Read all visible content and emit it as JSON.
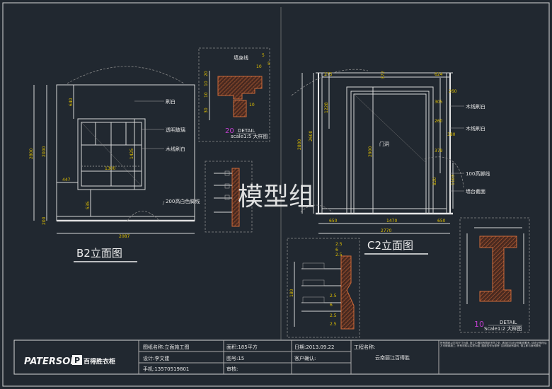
{
  "drawings": {
    "b2": {
      "title": "B2立面图",
      "labels": [
        "刷白",
        "透明玻璃",
        "木线刷白",
        "200高白色脚线"
      ],
      "dims": [
        "2800",
        "2000",
        "640",
        "1425",
        "1300",
        "447",
        "535",
        "200",
        "2087"
      ]
    },
    "c2": {
      "title": "C2立面图",
      "door_label": "门洞",
      "labels": [
        "木线刷白",
        "木线刷白",
        "100高脚线",
        "墙台截面"
      ],
      "dims": [
        "2800",
        "2600",
        "2900",
        "1228",
        "275",
        "372",
        "624",
        "260",
        "305",
        "260",
        "380",
        "379",
        "820",
        "1183",
        "650",
        "1470",
        "650",
        "2770"
      ]
    },
    "detail_small": {
      "label": "DETAIL",
      "number": "20",
      "sub": "scale1:5 大样图",
      "title": "墙身线",
      "dims": [
        "5",
        "5",
        "20",
        "10",
        "10",
        "10",
        "10",
        "20",
        "30",
        "20"
      ]
    },
    "detail_large": {
      "label": "DETAIL",
      "number": "10",
      "sub": "Scale1:2 大样图"
    },
    "profile_dims": [
      "2.5",
      "6",
      "2.5",
      "2.5",
      "6",
      "2.5",
      "2.5",
      "6",
      "2.5",
      "180"
    ],
    "watermark": "模型组"
  },
  "title_block": {
    "logo": "PATERSON",
    "logo_cn": "百得胜衣柜",
    "drawing_name": "图纸名称:立面施工图",
    "area": "面积:185平方",
    "date": "日期:2013.09.22",
    "project_label": "工程名称:",
    "project": "云南丽江百得胜",
    "designer": "设计:李文建",
    "drawing_no": "图号:15",
    "client_confirm": "客户确认:",
    "phone": "手机:13570519801",
    "review": "审核:",
    "note": "所有图纸以打印尺寸为准, 施工中遇到有图纸不符之处, 请及时与设计师取得联系, 待设计修改后方可继续施工; 所有材料以实样为准, 图纸仅作为参考; 如对图纸有疑问, 请立即与我司联系"
  },
  "colors": {
    "background": "#212830",
    "line": "#d8d8d8",
    "dimension": "#e0c000",
    "hatch": "#d06b3a",
    "detail_number": "#c23fd0"
  }
}
